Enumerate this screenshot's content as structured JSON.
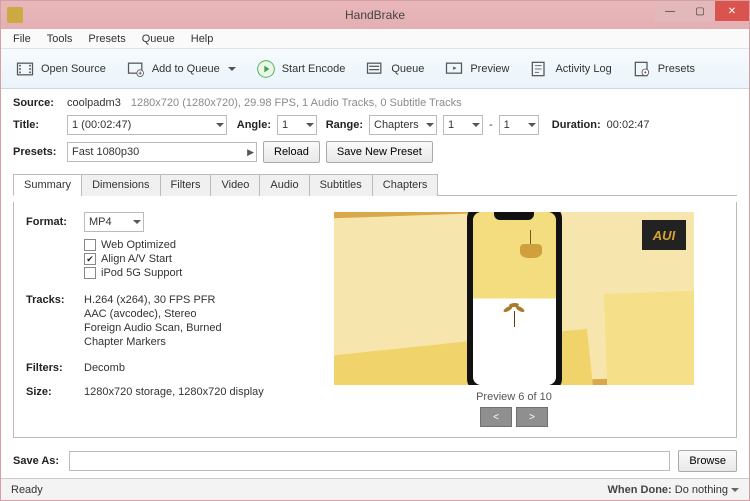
{
  "titlebar": {
    "title": "HandBrake"
  },
  "menu": [
    "File",
    "Tools",
    "Presets",
    "Queue",
    "Help"
  ],
  "toolbar": {
    "open_source": "Open Source",
    "add_to_queue": "Add to Queue",
    "start_encode": "Start Encode",
    "queue": "Queue",
    "preview": "Preview",
    "activity_log": "Activity Log",
    "presets": "Presets"
  },
  "source": {
    "label": "Source:",
    "name": "coolpadm3",
    "detail": "1280x720 (1280x720), 29.98 FPS, 1 Audio Tracks, 0 Subtitle Tracks"
  },
  "title_row": {
    "label": "Title:",
    "value": "1 (00:02:47)",
    "angle_label": "Angle:",
    "angle": "1",
    "range_label": "Range:",
    "range_mode": "Chapters",
    "range_from": "1",
    "range_dash": "-",
    "range_to": "1",
    "duration_label": "Duration:",
    "duration": "00:02:47"
  },
  "presets_row": {
    "label": "Presets:",
    "value": "Fast 1080p30",
    "reload": "Reload",
    "save_new": "Save New Preset"
  },
  "tabs": [
    "Summary",
    "Dimensions",
    "Filters",
    "Video",
    "Audio",
    "Subtitles",
    "Chapters"
  ],
  "summary": {
    "format_label": "Format:",
    "format": "MP4",
    "web_optimized": {
      "label": "Web Optimized",
      "checked": false
    },
    "align_av": {
      "label": "Align A/V Start",
      "checked": true
    },
    "ipod": {
      "label": "iPod 5G Support",
      "checked": false
    },
    "tracks_label": "Tracks:",
    "tracks": [
      "H.264 (x264), 30 FPS PFR",
      "AAC (avcodec), Stereo",
      "Foreign Audio Scan, Burned",
      "Chapter Markers"
    ],
    "filters_label": "Filters:",
    "filters": "Decomb",
    "size_label": "Size:",
    "size": "1280x720 storage, 1280x720 display"
  },
  "preview": {
    "badge": "AUI",
    "caption": "Preview 6 of 10",
    "prev": "<",
    "next": ">"
  },
  "save_as": {
    "label": "Save As:",
    "value": "",
    "browse": "Browse"
  },
  "status": {
    "left": "Ready",
    "when_done_label": "When Done:",
    "when_done": "Do nothing"
  }
}
